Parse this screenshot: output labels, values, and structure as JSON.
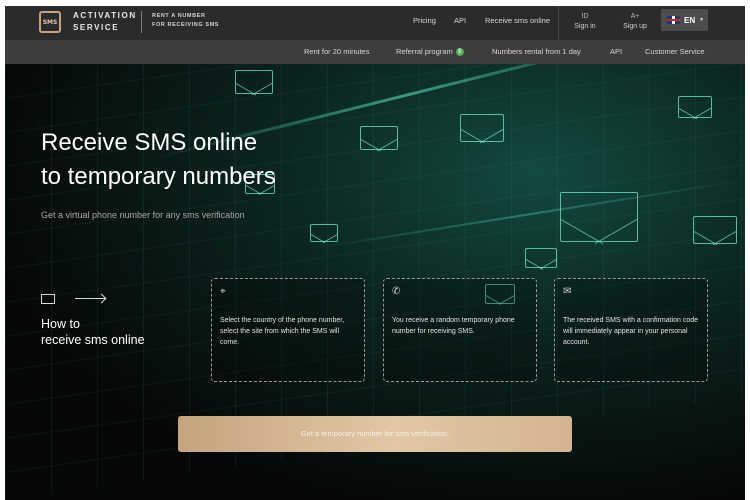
{
  "header": {
    "logo_text": "SMS",
    "brand_line1": "ACTIVATION",
    "brand_line2": "SERVICE",
    "tagline_line1": "RENT A NUMBER",
    "tagline_line2": "FOR RECEIVING SMS",
    "nav": [
      "Pricing",
      "API",
      "Receive sms online"
    ],
    "sign_in": "Sign in",
    "sign_up": "Sign up",
    "sign_in_icon": "ID",
    "sign_up_icon": "A+",
    "language": "EN"
  },
  "subnav": {
    "items": [
      "Rent for 20 minutes",
      "Referral program",
      "Numbers rental from 1 day",
      "API",
      "Customer Service"
    ],
    "referral_badge": "$"
  },
  "hero": {
    "title_line1": "Receive SMS online",
    "title_line2": "to temporary numbers",
    "subtitle": "Get a virtual phone number for any sms verification"
  },
  "how": {
    "title_line1": "How to",
    "title_line2": "receive sms online",
    "steps": [
      {
        "icon": "location-pin-icon",
        "text": "Select the country of the phone number, select the site from which the SMS will come."
      },
      {
        "icon": "phone-icon",
        "text": "You receive a random temporary phone number for receiving SMS."
      },
      {
        "icon": "message-icon",
        "text": "The received SMS with a confirmation code will immediately appear in your personal account."
      }
    ]
  },
  "cta": {
    "label": "Get a temporary number for sms verification."
  },
  "colors": {
    "accent_gold": "#d4b48e",
    "header_bg": "#2a2b2c",
    "subnav_bg": "#3c3d3f",
    "hero_glow": "#124a3f"
  }
}
